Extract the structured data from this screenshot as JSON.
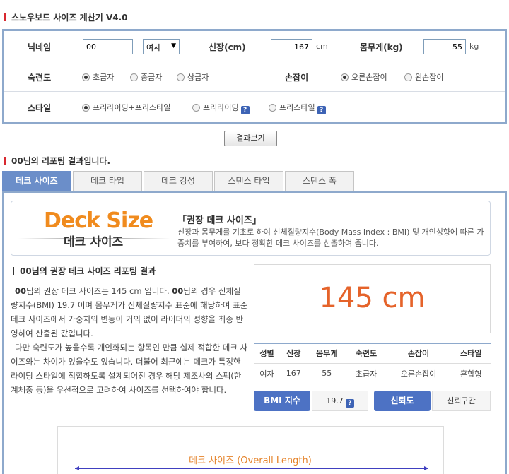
{
  "app": {
    "title": "스노우보드 사이즈 계산기 V4.0"
  },
  "form": {
    "nickname_label": "닉네임",
    "nickname_value": "00",
    "gender_value": "여자",
    "height_label": "신장(cm)",
    "height_value": "167",
    "height_unit": "cm",
    "weight_label": "몸무게(kg)",
    "weight_value": "55",
    "weight_unit": "kg",
    "skill_label": "숙련도",
    "skill_options": [
      "초급자",
      "중급자",
      "상급자"
    ],
    "skill_selected": "초급자",
    "stance_label": "손잡이",
    "stance_options": [
      "오른손잡이",
      "왼손잡이"
    ],
    "stance_selected": "오른손잡이",
    "style_label": "스타일",
    "style_options": [
      "프리라이딩+프리스타일",
      "프리라이딩",
      "프리스타일"
    ],
    "style_selected": "프리라이딩+프리스타일",
    "help_icon_text": "?"
  },
  "result_button": "결과보기",
  "report_header": "00님의 리포팅 결과입니다.",
  "tabs": [
    "데크 사이즈",
    "데크 타입",
    "데크 강성",
    "스탠스 타입",
    "스탠스 폭"
  ],
  "banner": {
    "logo_en": "Deck Size",
    "logo_ko": "데크 사이즈",
    "title": "「권장 데크 사이즈」",
    "desc": "신장과 몸무게를 기초로 하여 신체질량지수(Body Mass Index : BMI) 및 개인성향에 따른 가중치를 부여하여, 보다 정확한 데크 사이즈를 산출하여 줍니다."
  },
  "report": {
    "title": "00님의 권장 데크 사이즈 리포팅 결과",
    "p1_name": "00",
    "p1_a": "님의 권장 데크 사이즈는 145 cm 입니다. ",
    "p1_name2": "00",
    "p1_b": "님의 경우 신체질량지수(BMI) 19.7 이며 몸무게가 신체질량지수 표준에 해당하여 표준 데크 사이즈에서 가중치의 변동이 거의 없이 라이더의 성향을 최종 반영하여 산출된 값입니다.",
    "p2": "다만 숙련도가 높을수록 개인화되는 항목인 만큼 실제 적합한 데크 사이즈와는 차이가 있을수도 있습니다. 더불어 최근에는 데크가 특정한 라이딩 스타일에 적합하도록 설계되어진 경우 해당 제조사의 스펙(한계체중 등)을 우선적으로 고려하여 사이즈를 선택하여야 합니다."
  },
  "result": {
    "value": "145 cm"
  },
  "table": {
    "headers": [
      "성별",
      "신장",
      "몸무게",
      "숙련도",
      "손잡이",
      "스타일"
    ],
    "row": [
      "여자",
      "167",
      "55",
      "초급자",
      "오른손잡이",
      "혼합형"
    ]
  },
  "bmi": {
    "label": "BMI 지수",
    "value": "19.7"
  },
  "trust": {
    "label": "신뢰도",
    "value": "신뢰구간"
  },
  "diagram": {
    "label": "데크 사이즈 (Overall Length)"
  }
}
